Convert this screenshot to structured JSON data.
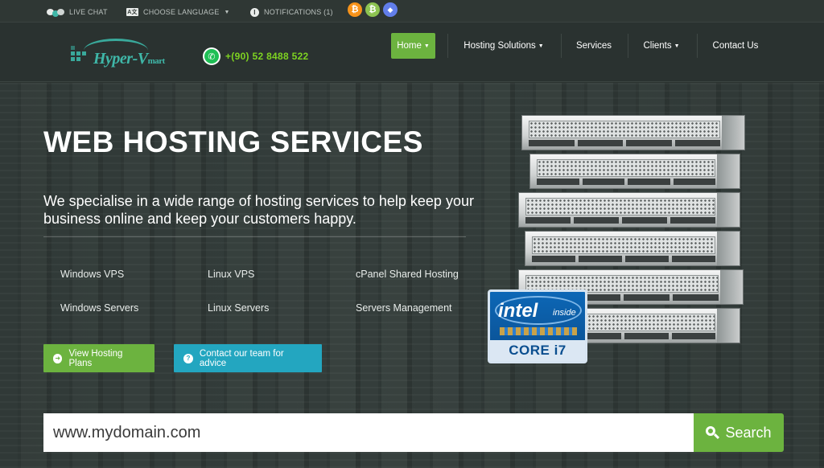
{
  "topbar": {
    "live_chat": "LIVE CHAT",
    "language": "CHOOSE LANGUAGE",
    "language_icon": "A文",
    "notifications": "NOTIFICATIONS (1)",
    "coins": [
      {
        "name": "bitcoin-icon",
        "glyph": "₿",
        "color": "#f7931a"
      },
      {
        "name": "bitcoin-cash-icon",
        "glyph": "₿",
        "color": "#8dc351"
      },
      {
        "name": "ethereum-icon",
        "glyph": "◆",
        "color": "#627eea"
      }
    ]
  },
  "header": {
    "logo_main": "Hyper-V",
    "logo_small": "mart",
    "phone": "+(90) 52 8488 522",
    "nav": [
      {
        "label": "Home",
        "caret": true,
        "active": true
      },
      {
        "label": "Hosting Solutions",
        "caret": true,
        "active": false
      },
      {
        "label": "Services",
        "caret": false,
        "active": false
      },
      {
        "label": "Clients",
        "caret": true,
        "active": false
      },
      {
        "label": "Contact Us",
        "caret": false,
        "active": false
      }
    ]
  },
  "hero": {
    "title": "WEB HOSTING SERVICES",
    "subtitle": "We specialise in a wide range of hosting services to help keep your business online and keep your customers happy.",
    "features": [
      "Windows VPS",
      "Linux VPS",
      "cPanel Shared Hosting",
      "Windows Servers",
      "Linux Servers",
      "Servers Management"
    ],
    "btn_plans": "View Hosting Plans",
    "btn_contact": "Contact our team for advice",
    "intel_brand": "intel",
    "intel_inside": "inside",
    "intel_core": "CORE i7"
  },
  "search": {
    "value": "www.mydomain.com",
    "button": "Search"
  },
  "colors": {
    "accent_green": "#6cb33f",
    "accent_blue": "#23a6c0",
    "phone_green": "#7ed321"
  }
}
